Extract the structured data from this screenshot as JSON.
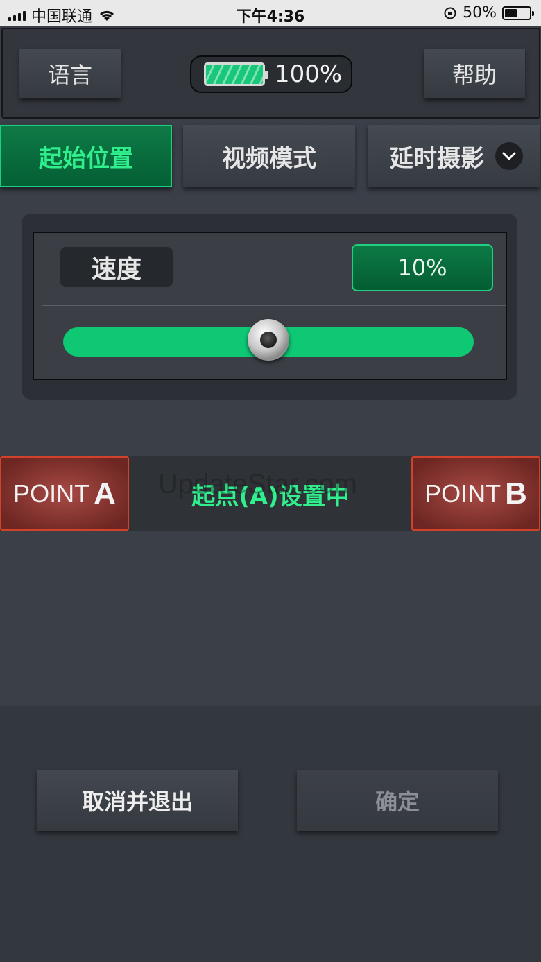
{
  "status_bar": {
    "carrier": "中国联通",
    "time": "下午4:36",
    "battery_percent_text": "50%",
    "battery_level": 0.5
  },
  "header": {
    "language_label": "语言",
    "battery_text": "100%",
    "battery_color": "#19c77a",
    "help_label": "帮助"
  },
  "tabs": [
    {
      "label": "起始位置",
      "active": true
    },
    {
      "label": "视频模式",
      "active": false
    },
    {
      "label": "延时摄影",
      "active": false
    }
  ],
  "speed": {
    "label": "速度",
    "value_text": "10%",
    "slider_position": 0.5,
    "accent_color": "#0ec874"
  },
  "points": {
    "a_prefix": "POINT",
    "a_letter": "A",
    "status_text": "起点(A)设置中",
    "b_prefix": "POINT",
    "b_letter": "B",
    "watermark": "UpdateStar.com"
  },
  "footer": {
    "cancel_label": "取消并退出",
    "confirm_label": "确定"
  }
}
